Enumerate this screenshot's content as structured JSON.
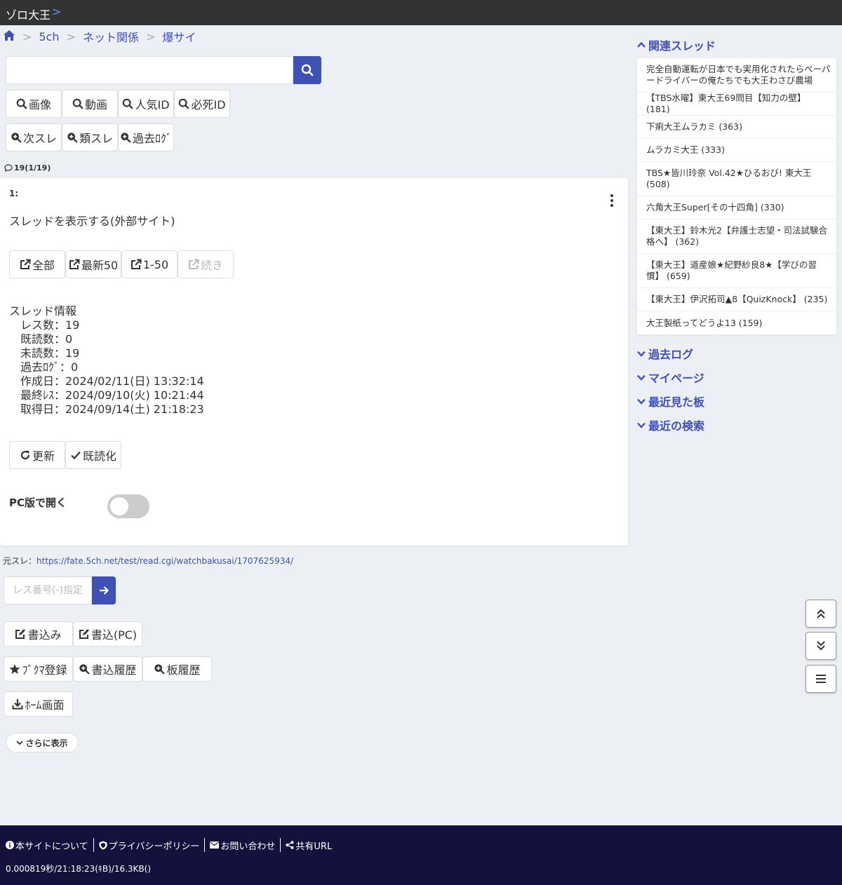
{
  "header": {
    "title": "ゾロ大王",
    "chevron": ">"
  },
  "breadcrumb": {
    "items": [
      "5ch",
      "ネット関係",
      "爆サイ"
    ],
    "separator": ">"
  },
  "search": {
    "placeholder": ""
  },
  "search_buttons": [
    "画像",
    "動画",
    "人気ID",
    "必死ID"
  ],
  "nav_buttons": [
    "次スレ",
    "類スレ",
    "過去ﾛｸﾞ"
  ],
  "res_count": "19(1/19)",
  "post": {
    "number": "1:",
    "link_text": "スレッドを表示する(外部サイト)",
    "open_buttons": [
      "全部",
      "最新50",
      "1-50",
      "続き"
    ],
    "info_title": "スレッド情報",
    "info_rows": [
      "レス数：19",
      "既読数：0",
      "未読数：19",
      "過去ﾛｸﾞ：0",
      "作成日：2024/02/11(日) 13:32:14",
      "最終ﾚｽ：2024/09/10(火) 10:21:44",
      "取得日：2024/09/14(土) 21:18:23"
    ],
    "action_buttons": [
      "更新",
      "既読化"
    ],
    "pc_label": "PC版で開く",
    "pc_toggle_on": false
  },
  "source": {
    "label": "元スレ：",
    "url": "https://fate.5ch.net/test/read.cgi/watchbakusai/1707625934/"
  },
  "res_jump": {
    "placeholder": "レス番号(-)指定"
  },
  "write_buttons": [
    "書込み",
    "書込(PC)"
  ],
  "history_buttons": [
    "ﾌﾞｸﾏ登録",
    "書込履歴",
    "板履歴"
  ],
  "home_button": "ﾎｰﾑ画面",
  "more_button": "さらに表示",
  "sidebar": {
    "related_title": "関連スレッド",
    "related": [
      "完全自動運転が日本でも実用化されたらペーパードライバーの俺たちでも大王わさび農場",
      "【TBS水曜】東大王69問目【知力の壁】 (181)",
      "下痢大王ムラカミ (363)",
      "ムラカミ大王 (333)",
      "TBS★皆川玲奈 Vol.42★ひるおび! 東大王 (508)",
      "六角大王Super[その十四角] (330)",
      "【東大王】鈴木光2【弁護士志望・司法試験合格へ】 (362)",
      "【東大王】道産娘★紀野紗良8★【学びの習慣】 (659)",
      "【東大王】伊沢拓司▲8【QuizKnock】 (235)",
      "大王製紙ってどうよ13 (159)"
    ],
    "sections": [
      "過去ログ",
      "マイページ",
      "最近見た板",
      "最近の検索"
    ]
  },
  "footer": {
    "links": [
      "本サイトについて",
      "プライバシーポリシー",
      "お問い合わせ",
      "共有URL"
    ],
    "stats": "0.000819秒/21:18:23(ｷB)/16.3KB()"
  },
  "colors": {
    "accent": "#3f51b5",
    "topbar": "#333333",
    "footer": "#14123d",
    "background": "#eceff3"
  }
}
